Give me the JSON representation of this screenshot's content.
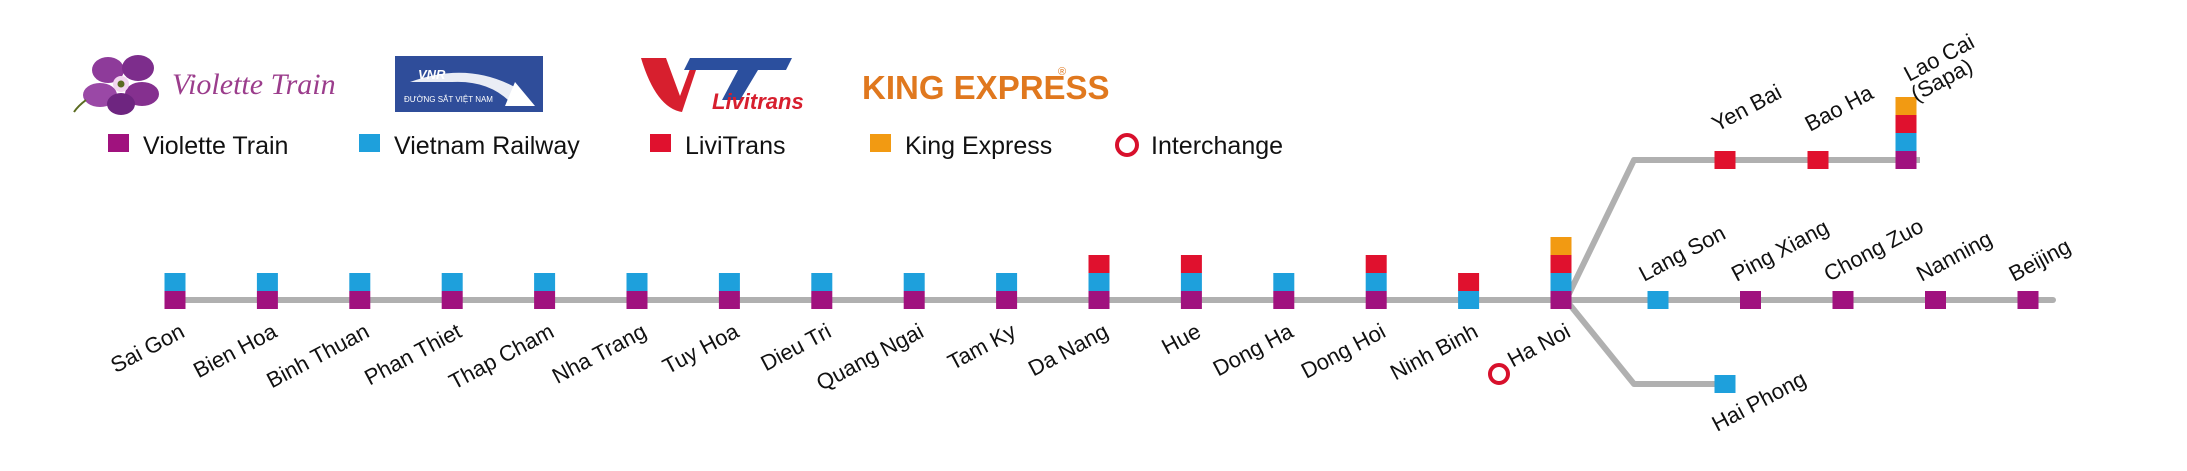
{
  "colors": {
    "line": "#b0b0b0",
    "violette": "#a0127e",
    "vietnam_railway": "#1ea0dc",
    "livitrans": "#e0112e",
    "king_express": "#f29a12",
    "interchange": "#d8102c"
  },
  "logos": {
    "violette": "Violette Train",
    "vietnam_railway": "ĐƯỜNG SẮT VIỆT NAM",
    "vietnam_railway_mark": "VNR",
    "livitrans": "Livitrans",
    "king_express": "KING EXPRESS",
    "king_express_mark": "®"
  },
  "legend": [
    {
      "label": "Violette Train",
      "color": "violette",
      "marker": "square"
    },
    {
      "label": "Vietnam Railway",
      "color": "vietnam_railway",
      "marker": "square"
    },
    {
      "label": "LiviTrans",
      "color": "livitrans",
      "marker": "square"
    },
    {
      "label": "King Express",
      "color": "king_express",
      "marker": "square"
    },
    {
      "label": "Interchange",
      "color": "interchange",
      "marker": "ring"
    }
  ],
  "main_line": [
    {
      "name": "Sai Gon",
      "services": [
        "violette",
        "vietnam_railway"
      ]
    },
    {
      "name": "Bien Hoa",
      "services": [
        "violette",
        "vietnam_railway"
      ]
    },
    {
      "name": "Binh Thuan",
      "services": [
        "violette",
        "vietnam_railway"
      ]
    },
    {
      "name": "Phan Thiet",
      "services": [
        "violette",
        "vietnam_railway"
      ]
    },
    {
      "name": "Thap Cham",
      "services": [
        "violette",
        "vietnam_railway"
      ]
    },
    {
      "name": "Nha Trang",
      "services": [
        "violette",
        "vietnam_railway"
      ]
    },
    {
      "name": "Tuy Hoa",
      "services": [
        "violette",
        "vietnam_railway"
      ]
    },
    {
      "name": "Dieu Tri",
      "services": [
        "violette",
        "vietnam_railway"
      ]
    },
    {
      "name": "Quang Ngai",
      "services": [
        "violette",
        "vietnam_railway"
      ]
    },
    {
      "name": "Tam Ky",
      "services": [
        "violette",
        "vietnam_railway"
      ]
    },
    {
      "name": "Da Nang",
      "services": [
        "violette",
        "vietnam_railway",
        "livitrans"
      ]
    },
    {
      "name": "Hue",
      "services": [
        "violette",
        "vietnam_railway",
        "livitrans"
      ]
    },
    {
      "name": "Dong Ha",
      "services": [
        "violette",
        "vietnam_railway"
      ]
    },
    {
      "name": "Dong Hoi",
      "services": [
        "violette",
        "vietnam_railway",
        "livitrans"
      ]
    },
    {
      "name": "Ninh Binh",
      "services": [
        "vietnam_railway",
        "livitrans"
      ]
    },
    {
      "name": "Ha Noi",
      "services": [
        "violette",
        "vietnam_railway",
        "livitrans",
        "king_express"
      ],
      "interchange": true
    }
  ],
  "north_east_line": [
    {
      "name": "Lang Son",
      "services": [
        "vietnam_railway"
      ]
    },
    {
      "name": "Ping Xiang",
      "services": [
        "violette"
      ]
    },
    {
      "name": "Chong Zuo",
      "services": [
        "violette"
      ]
    },
    {
      "name": "Nanning",
      "services": [
        "violette"
      ]
    },
    {
      "name": "Beijing",
      "services": [
        "violette"
      ]
    }
  ],
  "north_west_line": [
    {
      "name": "Yen Bai",
      "services": [
        "livitrans"
      ]
    },
    {
      "name": "Bao Ha",
      "services": [
        "livitrans"
      ]
    },
    {
      "name": "Lao Cai",
      "name_line2": "(Sapa)",
      "services": [
        "violette",
        "vietnam_railway",
        "livitrans",
        "king_express"
      ]
    }
  ],
  "haiphong_line": [
    {
      "name": "Hai Phong",
      "services": [
        "vietnam_railway"
      ]
    }
  ]
}
